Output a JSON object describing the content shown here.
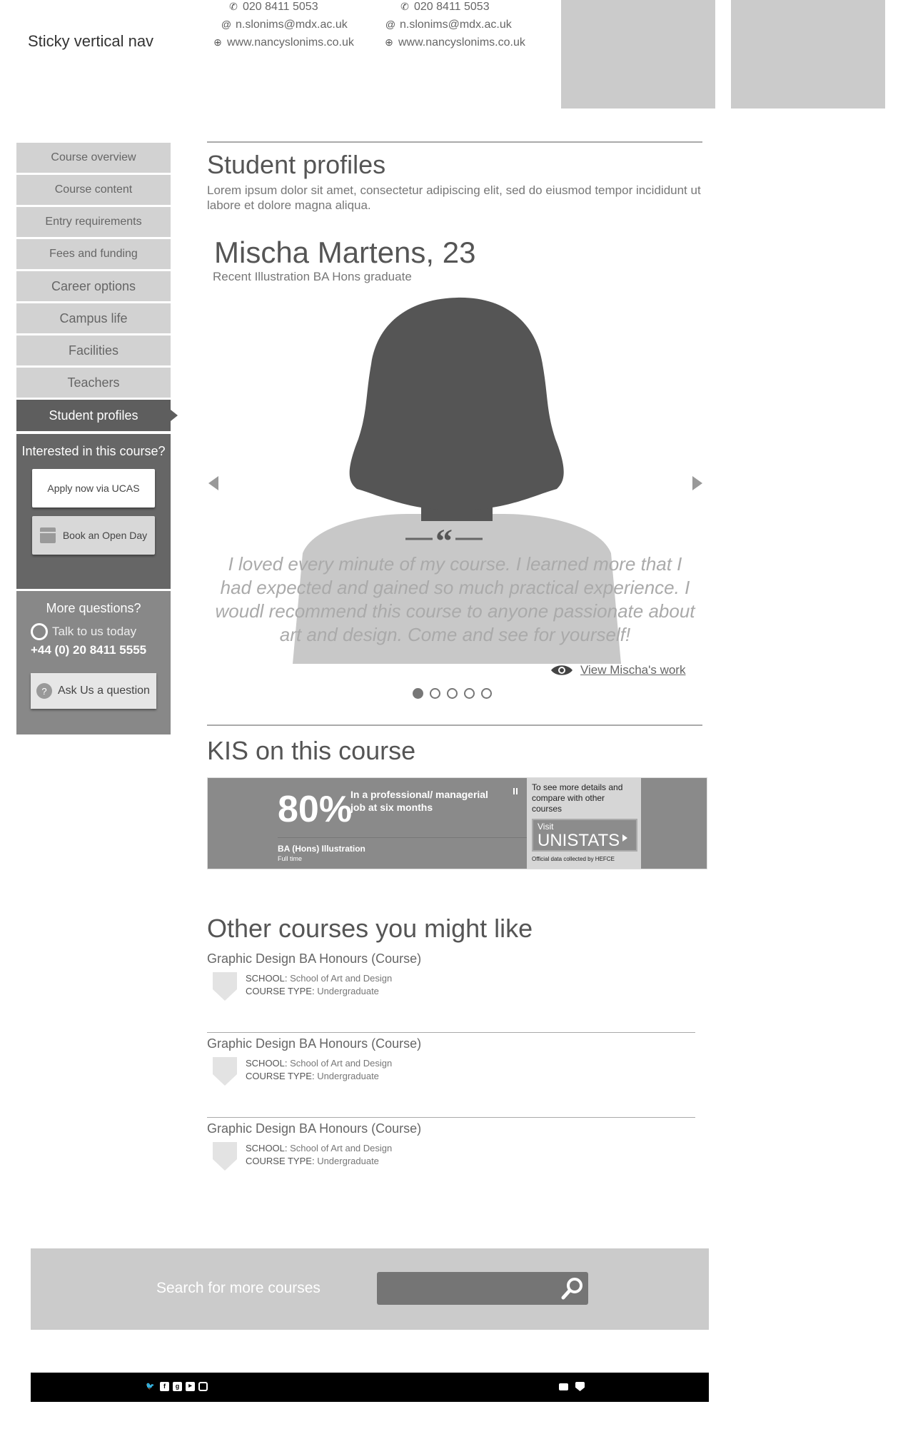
{
  "header": {
    "title": "Sticky vertical nav",
    "contacts": [
      {
        "phone": "020 8411 5053",
        "email": "n.slonims@mdx.ac.uk",
        "web": "www.nancyslonims.co.uk"
      },
      {
        "phone": "020 8411 5053",
        "email": "n.slonims@mdx.ac.uk",
        "web": "www.nancyslonims.co.uk"
      }
    ]
  },
  "nav": {
    "items": [
      {
        "label": "Course overview"
      },
      {
        "label": "Course content"
      },
      {
        "label": "Entry requirements"
      },
      {
        "label": "Fees and funding"
      },
      {
        "label": "Career options"
      },
      {
        "label": "Campus life"
      },
      {
        "label": "Facilities"
      },
      {
        "label": "Teachers"
      },
      {
        "label": "Student profiles",
        "active": true
      }
    ],
    "interested": {
      "heading": "Interested in this course?",
      "apply_label": "Apply now via UCAS",
      "openday_label": "Book an Open Day"
    },
    "questions": {
      "heading": "More questions?",
      "talk": "Talk to us today",
      "phone": "+44 (0) 20 8411 5555",
      "ask_label": "Ask Us a question"
    }
  },
  "profiles": {
    "heading": "Student profiles",
    "intro": "Lorem ipsum dolor sit amet, consectetur adipiscing elit, sed do eiusmod tempor incididunt ut labore et dolore magna aliqua.",
    "name": "Mischa Martens, 23",
    "subtitle": "Recent Illustration BA Hons graduate",
    "quote": "I loved every minute of my course. I learned more that I had expected and gained so much practical experience. I woudl recommend this course to anyone passionate about art and design. Come and see for yourself!",
    "view_work": "View Mischa's work",
    "slides": 5,
    "active_slide": 1
  },
  "kis": {
    "heading": "KIS on this course",
    "percent": "80%",
    "description": "In a professional/ managerial job at six months",
    "course": "BA (Hons) Illustration",
    "mode": "Full time",
    "compare": "To see more details and compare with other courses",
    "visit": "Visit",
    "unistats": "UNISTATS",
    "official": "Official data collected by HEFCE"
  },
  "other": {
    "heading": "Other courses you might like",
    "school_label": "SCHOOL:",
    "type_label": "COURSE TYPE:",
    "courses": [
      {
        "title": "Graphic Design BA Honours (Course)",
        "school": "School of Art and Design",
        "type": "Undergraduate"
      },
      {
        "title": "Graphic Design BA Honours (Course)",
        "school": "School of Art and Design",
        "type": "Undergraduate"
      },
      {
        "title": "Graphic Design BA Honours (Course)",
        "school": "School of Art and Design",
        "type": "Undergraduate"
      }
    ]
  },
  "search": {
    "label": "Search for more courses",
    "placeholder": ""
  },
  "colors": {
    "nav_bg": "#d2d2d2",
    "nav_active": "#5e5e5e",
    "panel_dark": "#666666",
    "panel_mid": "#888888",
    "footer": "#000000"
  }
}
